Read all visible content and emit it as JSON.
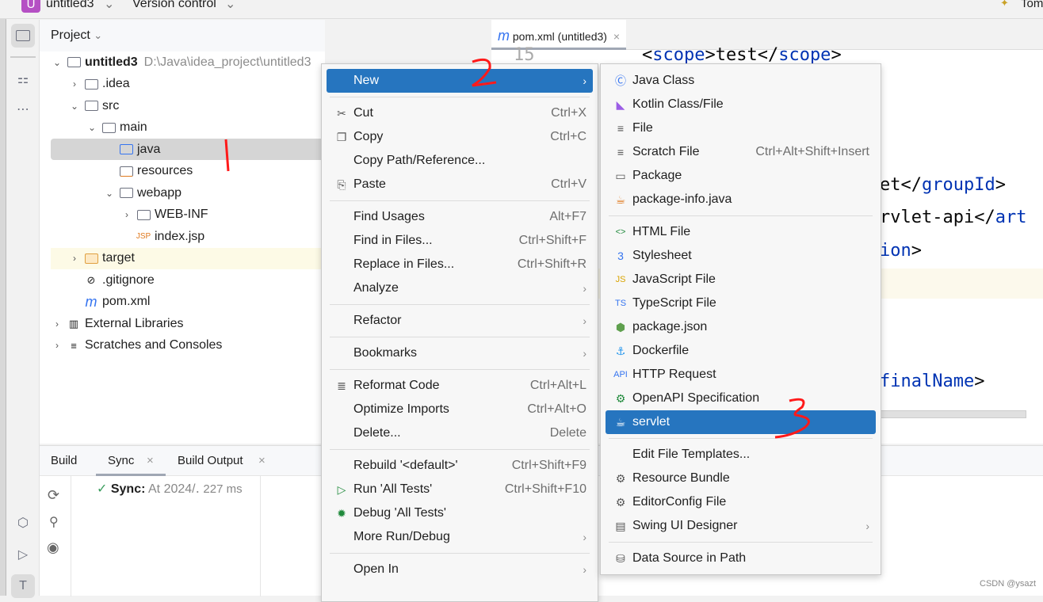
{
  "topbar": {
    "project_badge": "U",
    "project": "untitled3",
    "vcs": "Version control",
    "right_label": "Tom"
  },
  "project_panel": {
    "title": "Project",
    "tree": [
      {
        "label": "untitled3",
        "path": "D:\\Java\\idea_project\\untitled3",
        "level": 0,
        "chev": "down",
        "icon": "module-folder-icon",
        "bold": true
      },
      {
        "label": ".idea",
        "level": 1,
        "chev": "right",
        "icon": "folder-icon"
      },
      {
        "label": "src",
        "level": 1,
        "chev": "down",
        "icon": "folder-icon"
      },
      {
        "label": "main",
        "level": 2,
        "chev": "down",
        "icon": "folder-icon"
      },
      {
        "label": "java",
        "level": 3,
        "chev": "",
        "icon": "source-folder-icon",
        "selected": true
      },
      {
        "label": "resources",
        "level": 3,
        "chev": "",
        "icon": "resources-folder-icon"
      },
      {
        "label": "webapp",
        "level": 3,
        "chev": "down",
        "icon": "web-folder-icon"
      },
      {
        "label": "WEB-INF",
        "level": 4,
        "chev": "right",
        "icon": "folder-icon"
      },
      {
        "label": "index.jsp",
        "level": 4,
        "chev": "",
        "icon": "jsp-file-icon"
      },
      {
        "label": "target",
        "level": 1,
        "chev": "right",
        "icon": "excluded-folder-icon",
        "highlight": true
      },
      {
        "label": ".gitignore",
        "level": 1,
        "chev": "",
        "icon": "gitignore-icon"
      },
      {
        "label": "pom.xml",
        "level": 1,
        "chev": "",
        "icon": "maven-icon"
      },
      {
        "label": "External Libraries",
        "level": 0,
        "chev": "right",
        "icon": "library-icon"
      },
      {
        "label": "Scratches and Consoles",
        "level": 0,
        "chev": "right",
        "icon": "scratches-icon"
      }
    ]
  },
  "editor": {
    "tab": "pom.xml (untitled3)",
    "line_number": "15",
    "lines": [
      {
        "pre": "<",
        "tag": "scope",
        "mid": ">test</",
        "tag2": "scope",
        "post": ">"
      },
      {
        "text": "et</",
        "tag": "groupId",
        "post": ">"
      },
      {
        "text": "rvlet-api</",
        "tag": "art"
      },
      {
        "tag": "ion",
        "post": ">"
      },
      {
        "tag": "finalName",
        "post": ">"
      }
    ]
  },
  "build": {
    "tabs": [
      "Build",
      "Sync",
      "Build Output"
    ],
    "status_label": "Sync:",
    "status_text": "At 2024/․",
    "duration": "227 ms"
  },
  "context_menu": [
    {
      "label": "New",
      "arrow": true,
      "active": true
    },
    {
      "sep": true
    },
    {
      "label": "Cut",
      "shortcut": "Ctrl+X",
      "icon": "✂",
      "iconName": "cut-icon"
    },
    {
      "label": "Copy",
      "shortcut": "Ctrl+C",
      "icon": "❐",
      "iconName": "copy-icon"
    },
    {
      "label": "Copy Path/Reference..."
    },
    {
      "label": "Paste",
      "shortcut": "Ctrl+V",
      "icon": "⎘",
      "iconName": "paste-icon"
    },
    {
      "sep": true
    },
    {
      "label": "Find Usages",
      "shortcut": "Alt+F7"
    },
    {
      "label": "Find in Files...",
      "shortcut": "Ctrl+Shift+F"
    },
    {
      "label": "Replace in Files...",
      "shortcut": "Ctrl+Shift+R"
    },
    {
      "label": "Analyze",
      "arrow": true
    },
    {
      "sep": true
    },
    {
      "label": "Refactor",
      "arrow": true
    },
    {
      "sep": true
    },
    {
      "label": "Bookmarks",
      "arrow": true
    },
    {
      "sep": true
    },
    {
      "label": "Reformat Code",
      "shortcut": "Ctrl+Alt+L",
      "icon": "≣",
      "iconName": "reformat-icon"
    },
    {
      "label": "Optimize Imports",
      "shortcut": "Ctrl+Alt+O"
    },
    {
      "label": "Delete...",
      "shortcut": "Delete"
    },
    {
      "sep": true
    },
    {
      "label": "Rebuild '<default>'",
      "shortcut": "Ctrl+Shift+F9"
    },
    {
      "label": "Run 'All Tests'",
      "shortcut": "Ctrl+Shift+F10",
      "icon": "▷",
      "iconName": "run-icon",
      "iconColor": "#208a3c"
    },
    {
      "label": "Debug 'All Tests'",
      "icon": "✹",
      "iconName": "debug-icon",
      "iconColor": "#208a3c"
    },
    {
      "label": "More Run/Debug",
      "arrow": true
    },
    {
      "sep": true
    },
    {
      "label": "Open In",
      "arrow": true
    }
  ],
  "new_submenu": [
    {
      "label": "Java Class",
      "icon": "Ⓒ",
      "iconName": "java-class-icon",
      "iconColor": "#3574f0"
    },
    {
      "label": "Kotlin Class/File",
      "icon": "◣",
      "iconName": "kotlin-icon",
      "iconColor": "#9b5de5"
    },
    {
      "label": "File",
      "icon": "≡",
      "iconName": "file-icon"
    },
    {
      "label": "Scratch File",
      "shortcut": "Ctrl+Alt+Shift+Insert",
      "icon": "≡",
      "iconName": "scratch-file-icon"
    },
    {
      "label": "Package",
      "icon": "▭",
      "iconName": "package-icon"
    },
    {
      "label": "package-info.java",
      "icon": "☕",
      "iconName": "package-info-icon",
      "iconColor": "#e07a1f"
    },
    {
      "sep": true
    },
    {
      "label": "HTML File",
      "icon": "<>",
      "iconName": "html-icon",
      "iconColor": "#208a3c"
    },
    {
      "label": "Stylesheet",
      "icon": "3",
      "iconName": "css-icon",
      "iconColor": "#3574f0"
    },
    {
      "label": "JavaScript File",
      "icon": "JS",
      "iconName": "javascript-icon",
      "iconColor": "#d9a400"
    },
    {
      "label": "TypeScript File",
      "icon": "TS",
      "iconName": "typescript-icon",
      "iconColor": "#3574f0"
    },
    {
      "label": "package.json",
      "icon": "⬢",
      "iconName": "nodejs-icon",
      "iconColor": "#5fa04e"
    },
    {
      "label": "Dockerfile",
      "icon": "⚓",
      "iconName": "docker-icon",
      "iconColor": "#2496ed"
    },
    {
      "label": "HTTP Request",
      "icon": "API",
      "iconName": "http-request-icon",
      "iconColor": "#3574f0"
    },
    {
      "label": "OpenAPI Specification",
      "icon": "⚙",
      "iconName": "openapi-icon",
      "iconColor": "#208a3c"
    },
    {
      "label": "servlet",
      "icon": "☕",
      "iconName": "servlet-icon",
      "iconColor": "#e07a1f",
      "active": true
    },
    {
      "sep": true
    },
    {
      "label": "Edit File Templates..."
    },
    {
      "label": "Resource Bundle",
      "icon": "⚙",
      "iconName": "resource-bundle-icon"
    },
    {
      "label": "EditorConfig File",
      "icon": "⚙",
      "iconName": "editorconfig-icon"
    },
    {
      "label": "Swing UI Designer",
      "arrow": true,
      "icon": "▤",
      "iconName": "swing-icon"
    },
    {
      "sep": true
    },
    {
      "label": "Data Source in Path",
      "icon": "⛁",
      "iconName": "database-icon"
    }
  ],
  "watermark": "CSDN @ysazt",
  "colors": {
    "accent": "#2675bf",
    "annotation": "#ff1a1a",
    "xml_tag": "#0033b3"
  }
}
